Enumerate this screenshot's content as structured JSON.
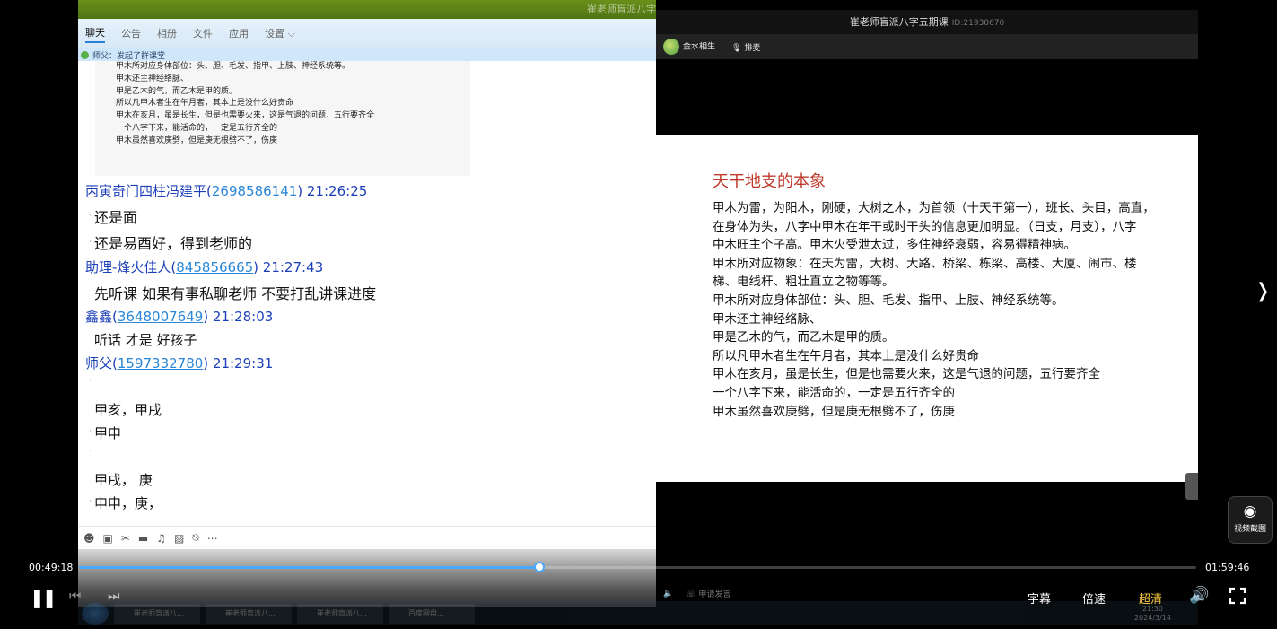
{
  "chat": {
    "window_title": "崔老师盲派八字五期课",
    "tabs": [
      "聊天",
      "公告",
      "相册",
      "文件",
      "应用",
      "设置 ⌵"
    ],
    "notice": "师父：发起了群课堂",
    "quoted_lines": [
      "甲木所对应身体部位：头、胆、毛发、指甲、上肢、神经系统等。",
      "甲木还主神经络脉、",
      "甲是乙木的气，而乙木是甲的质。",
      "所以凡甲木者生在午月者，其本上是没什么好贵命",
      "甲木在亥月，虽是长生，但是也需要火来，这是气退的问题，五行要齐全",
      "一个八字下来，能活命的，一定是五行齐全的",
      "甲木虽然喜欢庚劈，但是庚无根劈不了，伤庚"
    ],
    "messages": [
      {
        "sender": "丙寅奇门四柱冯建平(",
        "qq": "2698586141",
        "time": ")  21:26:25"
      },
      {
        "sender": "助理-烽火佳人(",
        "qq": "845856665",
        "time": ")  21:27:43"
      },
      {
        "sender": "鑫鑫(",
        "qq": "3648007649",
        "time": ")  21:28:03"
      },
      {
        "sender": "师父(",
        "qq": "1597332780",
        "time": ")  21:29:31"
      }
    ],
    "lines": {
      "l1": "还是面",
      "l2": "还是易酉好，得到老师的",
      "l3": "先听课 如果有事私聊老师 不要打乱讲课进度",
      "l4": "听话 才是 好孩子",
      "l5": "甲亥，甲戌",
      "l6": "甲申",
      "l7": "甲戌， 庚",
      "l8": "申申，庚，"
    }
  },
  "live": {
    "title": "崔老师盲派八字五期课",
    "id": "ID:21930670",
    "presenter": "金水相生",
    "mic_label": "排麦",
    "request_speak": "申请发言",
    "slide_title": "天干地支的本象",
    "slide_lines": [
      "甲木为雷，为阳木，刚硬，大树之木，为首领（十天干第一），班长、头目，高直，",
      "在身体为头，八字中甲木在年干或时干头的信息更加明显。（日支，月支），八字",
      "中木旺主个子高。甲木火受泄太过，多住神经衰弱，容易得精神病。",
      "甲木所对应物象：在天为雷，大树、大路、桥梁、栋梁、高楼、大厦、闹市、楼",
      "梯、电线杆、粗壮直立之物等等。",
      "甲木所对应身体部位：头、胆、毛发、指甲、上肢、神经系统等。",
      "甲木还主神经络脉、",
      "甲是乙木的气，而乙木是甲的质。",
      "所以凡甲木者生在午月者，其本上是没什么好贵命",
      "甲木在亥月，虽是长生，但是也需要火来，这是气退的问题，五行要齐全",
      "一个八字下来，能活命的，一定是五行齐全的",
      "甲木虽然喜欢庚劈，但是庚无根劈不了，伤庚"
    ]
  },
  "player": {
    "current_time": "00:49:18",
    "total_time": "01:59:46",
    "progress_fraction": 0.4118,
    "subtitle_label": "字幕",
    "speed_label": "倍速",
    "quality_label": "超清",
    "screenshot_label": "视频截图",
    "accent_color": "#4aa8ff"
  },
  "taskbar": {
    "tasks": [
      "崔老师盲派八...",
      "崔老师盲派八...",
      "崔老师盲派八...",
      "百度网盘..."
    ],
    "clock_time": "21:30",
    "clock_date": "2024/3/14"
  }
}
